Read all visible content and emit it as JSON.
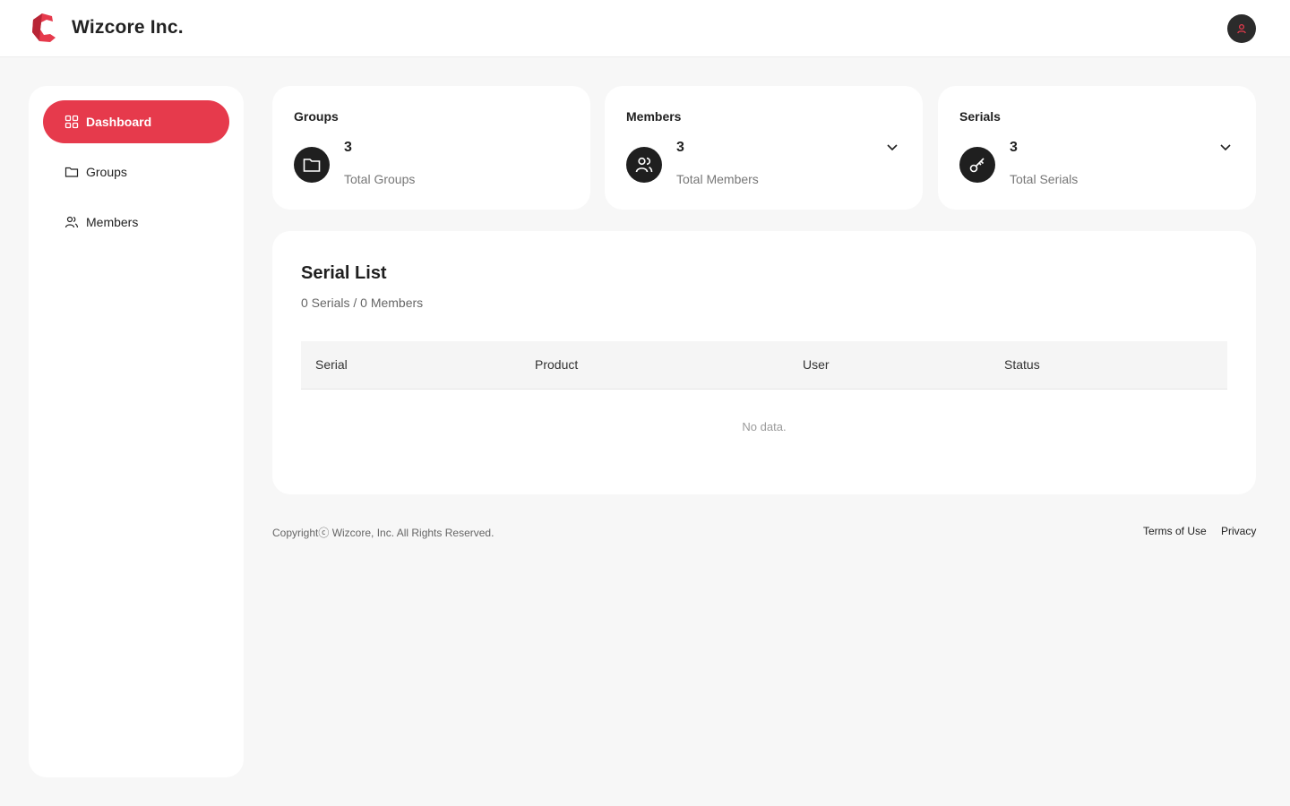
{
  "header": {
    "brand_name": "Wizcore Inc.",
    "brand_color": "#e63a4c",
    "avatar_icon": "user-icon"
  },
  "sidebar": {
    "items": [
      {
        "label": "Dashboard",
        "icon": "dashboard-grid-icon",
        "active": true
      },
      {
        "label": "Groups",
        "icon": "folder-icon",
        "active": false
      },
      {
        "label": "Members",
        "icon": "users-icon",
        "active": false
      }
    ]
  },
  "cards": [
    {
      "title": "Groups",
      "value": "3",
      "label": "Total Groups",
      "icon": "folder-icon",
      "has_dropdown": false
    },
    {
      "title": "Members",
      "value": "3",
      "label": "Total Members",
      "icon": "users-icon",
      "has_dropdown": true
    },
    {
      "title": "Serials",
      "value": "3",
      "label": "Total Serials",
      "icon": "key-icon",
      "has_dropdown": true
    }
  ],
  "serial_list": {
    "title": "Serial List",
    "subtitle": "0 Serials / 0 Members",
    "columns": [
      "Serial",
      "Product",
      "User",
      "Status"
    ],
    "rows": [],
    "empty_text": "No data."
  },
  "footer": {
    "copyright": "Copyrightⓒ Wizcore, Inc. All Rights Reserved.",
    "terms": "Terms of Use",
    "privacy": "Privacy"
  }
}
